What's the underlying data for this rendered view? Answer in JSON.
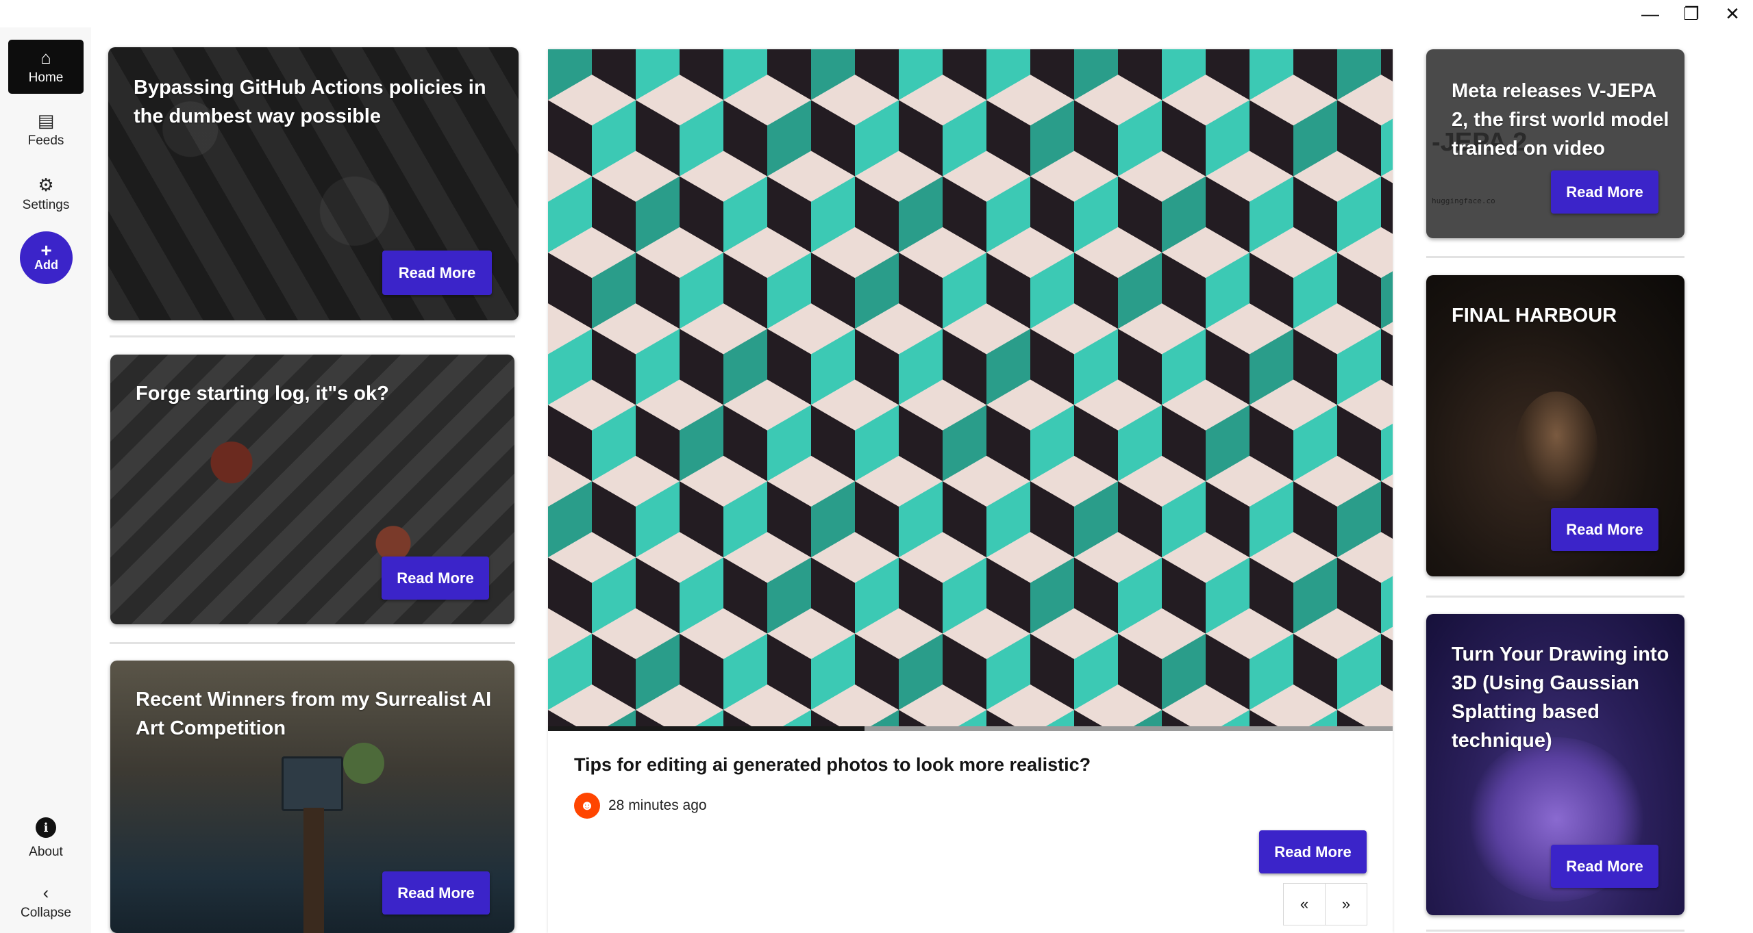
{
  "window": {
    "minimize_icon": "minimize-icon",
    "restore_icon": "restore-icon",
    "close_icon": "close-icon",
    "minimize_glyph": "—",
    "restore_glyph": "❐",
    "close_glyph": "✕"
  },
  "sidebar": {
    "home": "Home",
    "feeds": "Feeds",
    "settings": "Settings",
    "add": "Add",
    "about": "About",
    "collapse": "Collapse"
  },
  "left_cards": [
    {
      "title": "Bypassing GitHub Actions policies in the dumbest way possible",
      "button": "Read More"
    },
    {
      "title": "Forge starting log, it\"s ok?",
      "button": "Read More"
    },
    {
      "title": "Recent Winners from my Surrealist AI Art Competition",
      "button": "Read More"
    }
  ],
  "featured": {
    "title": "Tips for editing ai generated photos to look more realistic?",
    "time": "28 minutes ago",
    "button": "Read More",
    "progress": 0.375,
    "prev": "«",
    "next": "»"
  },
  "right_cards": [
    {
      "title": "Meta releases V-JEPA 2, the first world model trained on video",
      "button": "Read More",
      "bg_text": "-JEPA 2",
      "bg_small": "huggingface.co"
    },
    {
      "title": "FINAL HARBOUR",
      "button": "Read More"
    },
    {
      "title": "Turn Your Drawing into 3D (Using Gaussian Splatting based technique)",
      "button": "Read More"
    }
  ],
  "colors": {
    "accent": "#3b24c9",
    "sidebar_bg": "#f7f7f7",
    "teal": "#3cc9b4"
  }
}
